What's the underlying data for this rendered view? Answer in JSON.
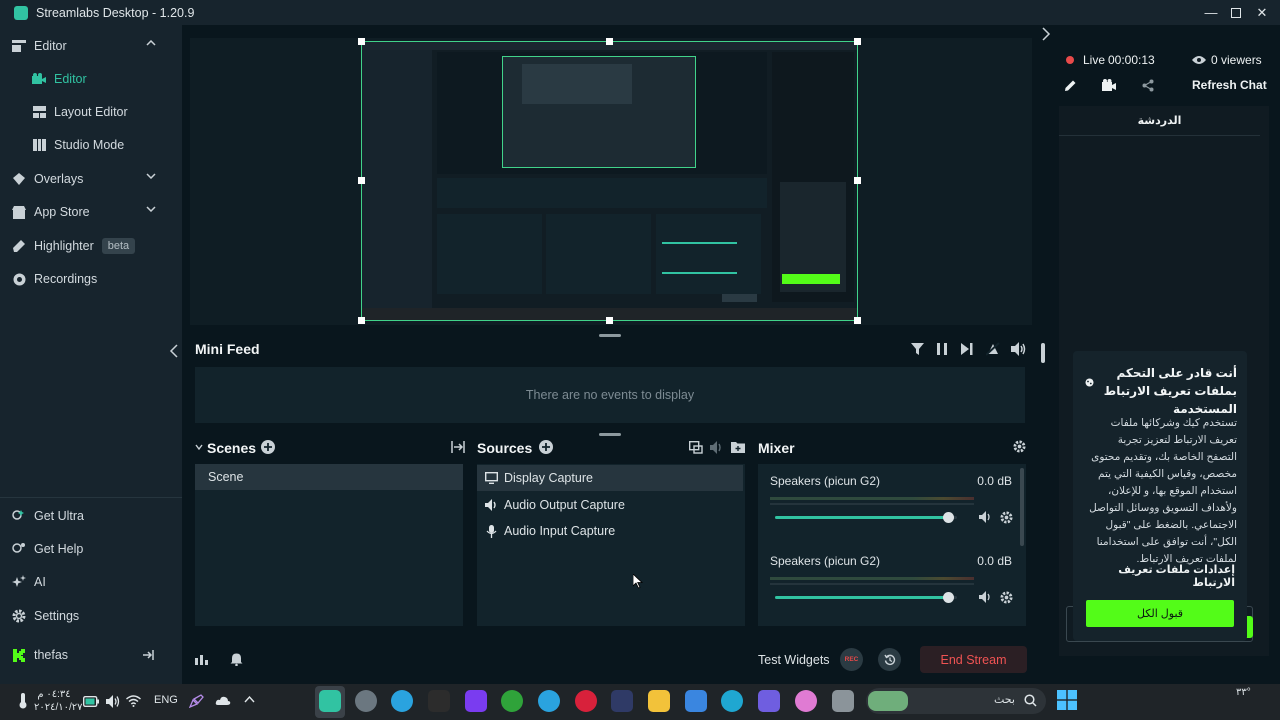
{
  "window": {
    "title": "Streamlabs Desktop - 1.20.9"
  },
  "sidebar": {
    "items": [
      {
        "label": "Editor"
      },
      {
        "label": "Editor"
      },
      {
        "label": "Layout Editor"
      },
      {
        "label": "Studio Mode"
      },
      {
        "label": "Overlays"
      },
      {
        "label": "App Store"
      },
      {
        "label": "Highlighter",
        "badge": "beta"
      },
      {
        "label": "Recordings"
      }
    ],
    "bottom_items": [
      {
        "label": "Get Ultra"
      },
      {
        "label": "Get Help"
      },
      {
        "label": "AI"
      },
      {
        "label": "Settings"
      },
      {
        "label": "thefas"
      }
    ]
  },
  "minifeed": {
    "title": "Mini Feed",
    "empty_text": "There are no events to display"
  },
  "scenes": {
    "title": "Scenes",
    "items": [
      "Scene"
    ]
  },
  "sources": {
    "title": "Sources",
    "items": [
      "Display Capture",
      "Audio Output Capture",
      "Audio Input Capture"
    ]
  },
  "mixer": {
    "title": "Mixer",
    "channels": [
      {
        "name": "Speakers (picun G2)",
        "level": "0.0 dB",
        "volume": 0.95
      },
      {
        "name": "Speakers (picun G2)",
        "level": "0.0 dB",
        "volume": 0.95
      }
    ]
  },
  "bottom_bar": {
    "test_widgets": "Test Widgets",
    "rec": "REC",
    "end_stream": "End Stream"
  },
  "live": {
    "status": "Live",
    "time": "00:00:13",
    "viewers": "0 viewers",
    "refresh": "Refresh Chat",
    "chat_tab": "الدردشة"
  },
  "cookie": {
    "title": "أنت قادر على التحكم بملفات تعريف الارتباط المستخدمة",
    "body": "تستخدم كيك وشركائها ملفات تعريف الارتباط لتعزيز تجربة التصفح الخاصة بك، وتقديم محتوى مخصص، وقياس الكيفية التي يتم استخدام الموقع بها، و للإعلان، ولأهداف التسويق ووسائل التواصل الاجتماعي. بالضغط على \"قبول الكل\"، أنت توافق على استخدامنا لملفات تعريف الارتباط.",
    "settings": "إعدادات ملفات تعريف الارتباط",
    "accept": "قبول الكل"
  },
  "taskbar": {
    "time": "٠٤:٣٤ م",
    "date": "٢٠٢٤/١٠/٢٧",
    "lang": "ENG",
    "search": "بحث",
    "temp": "٣٣°"
  },
  "colors": {
    "accent": "#31c3a2",
    "live": "#e84a4a",
    "end_stream": "#ef5353",
    "accept": "#53fc18"
  }
}
